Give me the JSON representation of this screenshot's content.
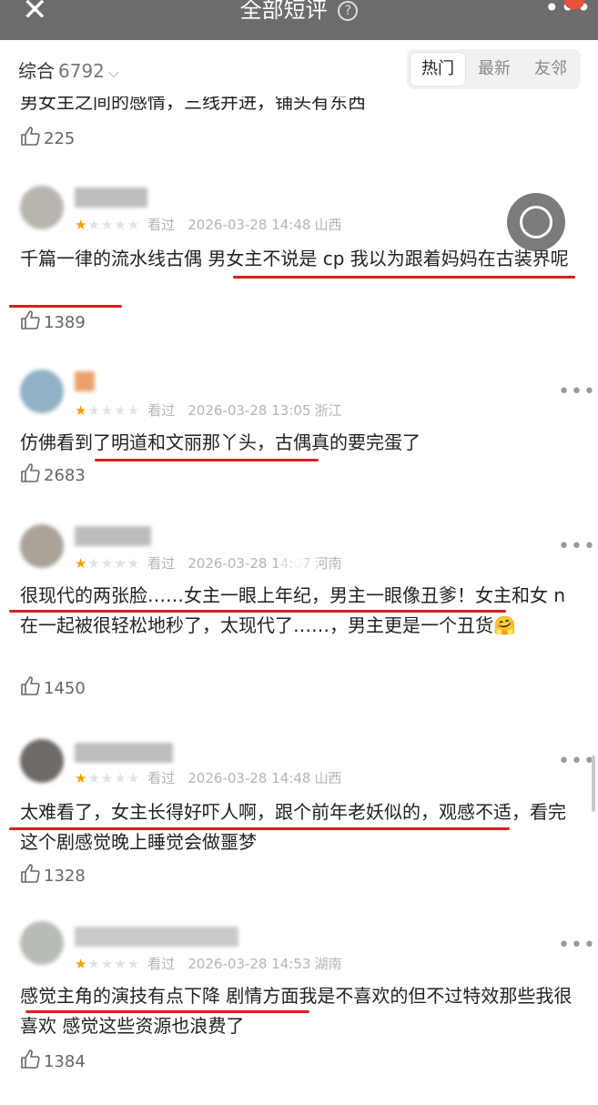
{
  "header": {
    "close_icon": "close-icon",
    "title": "全部短评",
    "help_glyph": "?",
    "more_glyph": "•••"
  },
  "filter": {
    "sort_label": "综合",
    "count": "6792",
    "tabs": [
      "热门",
      "最新",
      "友邻"
    ],
    "active_tab": "热门"
  },
  "comments": [
    {
      "text": "男女主之间的感情，三线并进，铺头有东西",
      "likes": "225"
    },
    {
      "rating": 1,
      "label": "看过",
      "date": "2026-03-28 14:48",
      "location": "山西",
      "text": "千篇一律的流水线古偶 男女主不说是 cp 我以为跟着妈妈在古装界呢",
      "likes": "1389"
    },
    {
      "rating": 1,
      "label": "看过",
      "date": "2026-03-28 13:05",
      "location": "浙江",
      "text": "仿佛看到了明道和文丽那丫头，古偶真的要完蛋了",
      "likes": "2683"
    },
    {
      "rating": 1,
      "label": "看过",
      "date": "2026-03-28 14:07",
      "location": "河南",
      "text": "很现代的两张脸……女主一眼上年纪，男主一眼像丑爹！女主和女 n 在一起被很轻松地秒了，太现代了……，男主更是一个丑货🤗",
      "likes": "1450"
    },
    {
      "rating": 1,
      "label": "看过",
      "date": "2026-03-28 14:48",
      "location": "山西",
      "text": "太难看了，女主长得好吓人啊，跟个前年老妖似的，观感不适，看完这个剧感觉晚上睡觉会做噩梦",
      "likes": "1328"
    },
    {
      "rating": 1,
      "label": "看过",
      "date": "2026-03-28 14:53",
      "location": "湖南",
      "text": "感觉主角的演技有点下降 剧情方面我是不喜欢的但不过特效那些我很喜欢 感觉这些资源也浪费了",
      "likes": "1384"
    }
  ],
  "colors": {
    "header_bg": "#6c6c6c",
    "star_on": "#f4a000",
    "star_off": "#e2e2e2",
    "underline_red": "#d6201c"
  }
}
